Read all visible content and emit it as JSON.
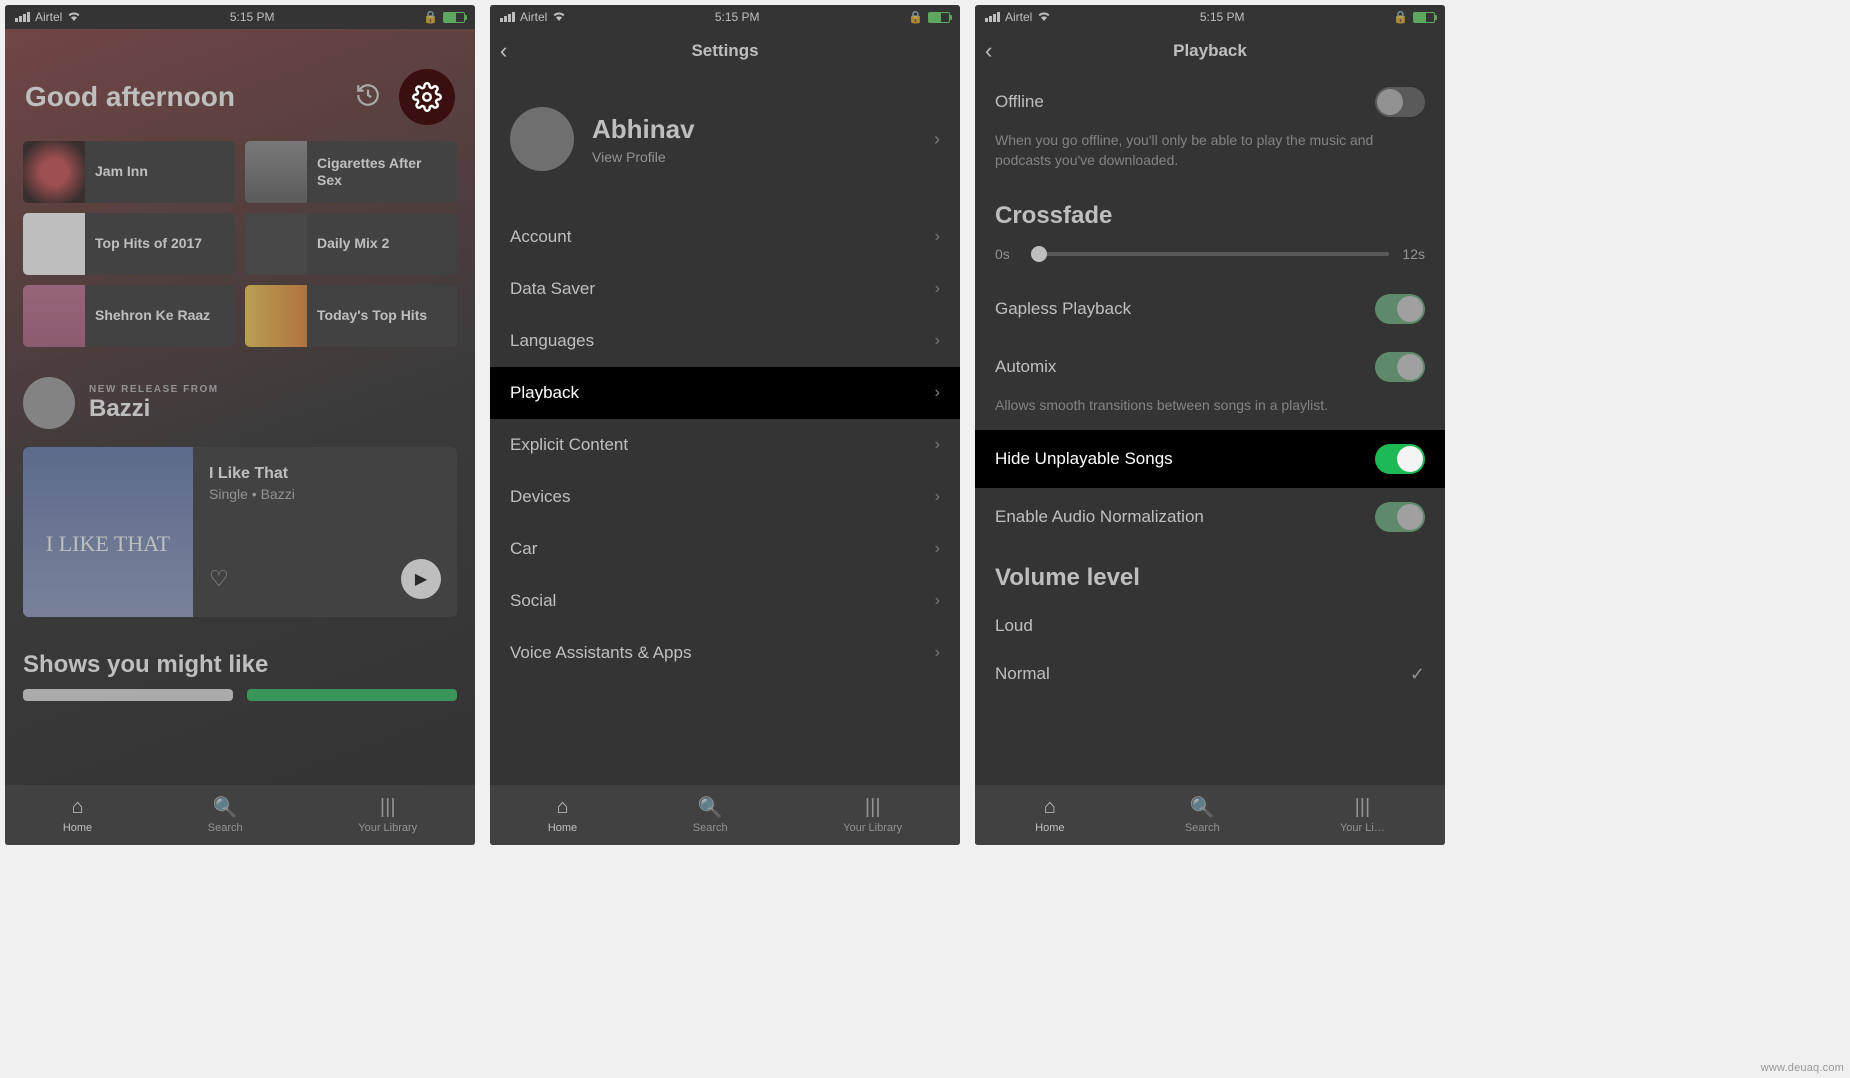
{
  "status_bar": {
    "carrier": "Airtel",
    "time": "5:15 PM"
  },
  "tab_bar": {
    "home": "Home",
    "search": "Search",
    "library": "Your Library",
    "library_trunc": "Your Li…"
  },
  "screen1": {
    "greeting": "Good afternoon",
    "tiles": [
      {
        "label": "Jam Inn"
      },
      {
        "label": "Cigarettes After Sex"
      },
      {
        "label": "Top Hits of 2017"
      },
      {
        "label": "Daily Mix 2"
      },
      {
        "label": "Shehron Ke Raaz"
      },
      {
        "label": "Today's Top Hits"
      }
    ],
    "release_from_label": "NEW RELEASE FROM",
    "release_artist": "Bazzi",
    "release_card": {
      "cover_text": "I LIKE THAT",
      "title": "I Like That",
      "subtitle": "Single • Bazzi"
    },
    "shows_header": "Shows you might like"
  },
  "screen2": {
    "title": "Settings",
    "profile": {
      "name": "Abhinav",
      "view_profile": "View Profile"
    },
    "items": [
      "Account",
      "Data Saver",
      "Languages",
      "Playback",
      "Explicit Content",
      "Devices",
      "Car",
      "Social",
      "Voice Assistants & Apps"
    ],
    "highlight_index": 3
  },
  "screen3": {
    "title": "Playback",
    "offline": {
      "label": "Offline",
      "desc": "When you go offline, you'll only be able to play the music and podcasts you've downloaded."
    },
    "crossfade": {
      "header": "Crossfade",
      "min_label": "0s",
      "max_label": "12s"
    },
    "gapless": "Gapless Playback",
    "automix": "Automix",
    "automix_desc": "Allows smooth transitions between songs in a playlist.",
    "hide_unplayable": "Hide Unplayable Songs",
    "normalization": "Enable Audio Normalization",
    "volume_header": "Volume level",
    "volume_options": [
      "Loud",
      "Normal"
    ],
    "volume_selected_index": 1
  },
  "watermark": "www.deuaq.com"
}
